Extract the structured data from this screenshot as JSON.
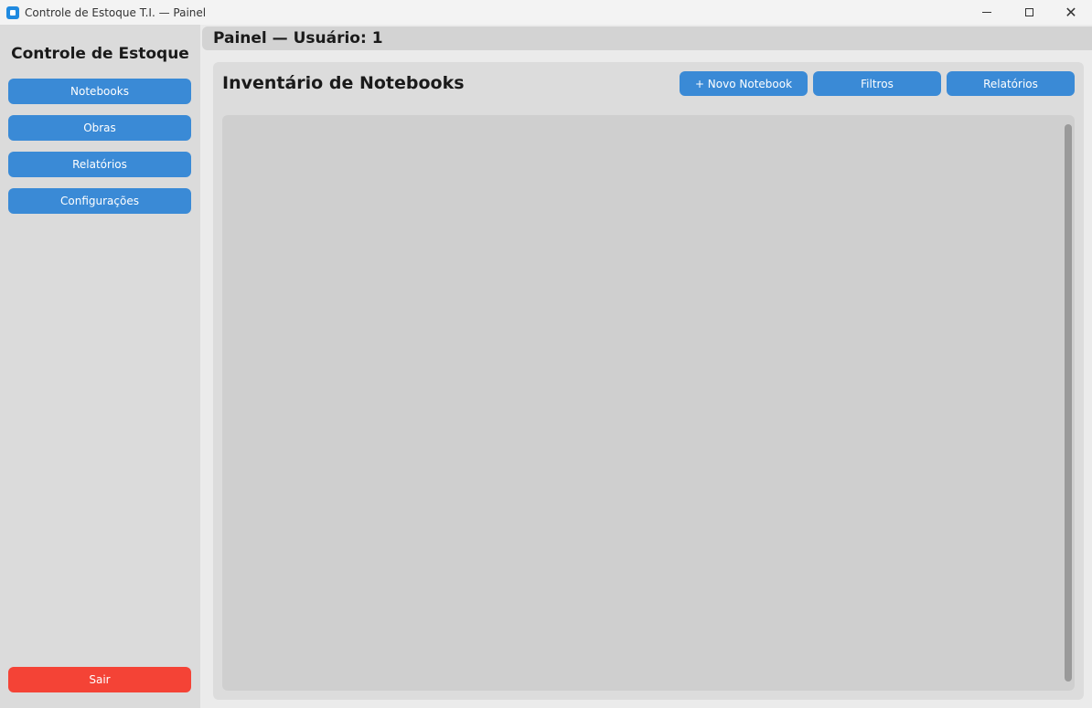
{
  "window": {
    "title": "Controle de Estoque T.I. — Painel",
    "controls": {
      "minimize": "minimize-icon",
      "maximize": "maximize-icon",
      "close": "✕"
    }
  },
  "sidebar": {
    "title": "Controle de Estoque",
    "items": [
      {
        "label": "Notebooks"
      },
      {
        "label": "Obras"
      },
      {
        "label": "Relatórios"
      },
      {
        "label": "Configurações"
      }
    ],
    "exit_label": "Sair"
  },
  "header": {
    "title": "Painel — Usuário: 1"
  },
  "main": {
    "title": "Inventário de Notebooks",
    "actions": [
      {
        "label": "+ Novo Notebook"
      },
      {
        "label": "Filtros"
      },
      {
        "label": "Relatórios"
      }
    ]
  },
  "colors": {
    "accent": "#3a8ad6",
    "danger": "#f44336",
    "sidebar_bg": "#dbdbdb",
    "panel_bg": "#dcdcdc",
    "list_bg": "#cfcfcf"
  }
}
